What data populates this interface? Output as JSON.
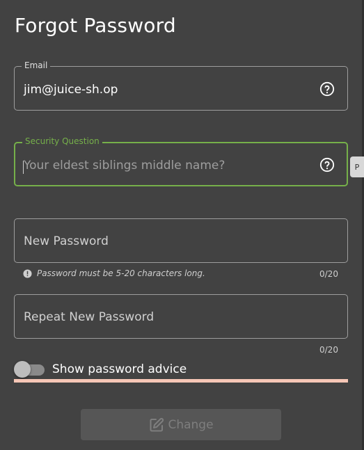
{
  "page": {
    "title": "Forgot Password"
  },
  "email": {
    "label": "Email",
    "value": "jim@juice-sh.op",
    "help_icon": "help-circle-icon"
  },
  "security_question": {
    "label": "Security Question",
    "placeholder": "Your eldest siblings middle name?",
    "help_icon": "help-circle-icon"
  },
  "new_password": {
    "label": "New Password",
    "hint": "Password must be 5-20 characters long.",
    "counter": "0/20"
  },
  "repeat_password": {
    "label": "Repeat New Password",
    "counter": "0/20"
  },
  "advice_toggle": {
    "label": "Show password advice",
    "checked": false
  },
  "change_button": {
    "label": "Change",
    "icon": "edit-icon",
    "disabled": true
  },
  "side_tab": {
    "label": "P"
  },
  "colors": {
    "accent_green": "#76b04a",
    "underline_highlight": "#f6c6b6",
    "card_bg": "#424242"
  }
}
